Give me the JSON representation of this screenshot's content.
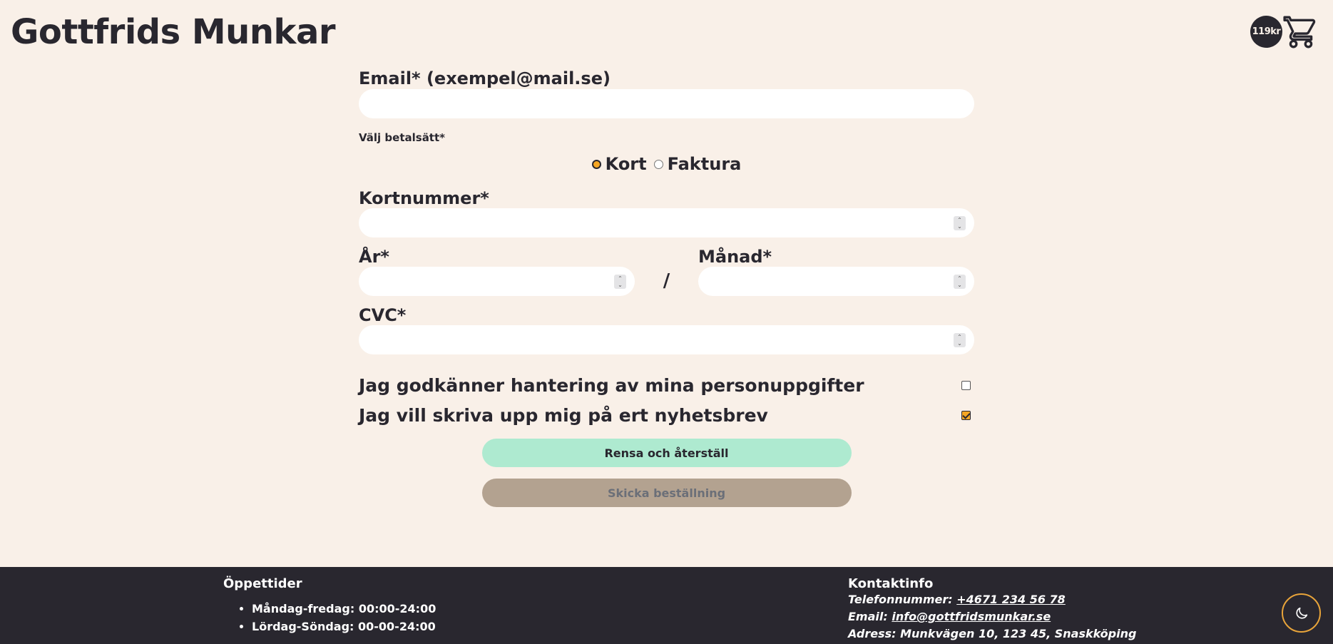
{
  "header": {
    "logo": "Gottfrids Munkar",
    "cart_total": "119kr",
    "cart_icon": "shopping-cart-icon"
  },
  "form": {
    "email_label": "Email* (exempel@mail.se)",
    "email_value": "",
    "payment_label": "Välj betalsätt*",
    "payment_options": [
      {
        "label": "Kort",
        "selected": true
      },
      {
        "label": "Faktura",
        "selected": false
      }
    ],
    "card_number_label": "Kortnummer*",
    "year_label": "År*",
    "separator": "/",
    "month_label": "Månad*",
    "cvc_label": "CVC*",
    "consent_label": "Jag godkänner hantering av mina personuppgifter",
    "consent_checked": false,
    "newsletter_label": "Jag vill skriva upp mig på ert nyhetsbrev",
    "newsletter_checked": true,
    "reset_button": "Rensa och återställ",
    "submit_button": "Skicka beställning"
  },
  "footer": {
    "hours_title": "Öppettider",
    "hours": [
      "Måndag-fredag: 00:00-24:00",
      "Lördag-Söndag: 00-00-24:00"
    ],
    "contact_title": "Kontaktinfo",
    "phone_label": "Telefonnummer:",
    "phone": "+4671 234 56 78",
    "email_label": "Email:",
    "email": "info@gottfridsmunkar.se",
    "address": "Adress: Munkvägen 10, 123 45, Snaskköping"
  },
  "theme_toggle_icon": "moon-icon",
  "colors": {
    "background": "#f9f0e8",
    "text": "#29272f",
    "accent": "#f5a623",
    "reset_button": "#aeead0",
    "submit_button_disabled": "#b3a290",
    "footer": "#29272f"
  }
}
